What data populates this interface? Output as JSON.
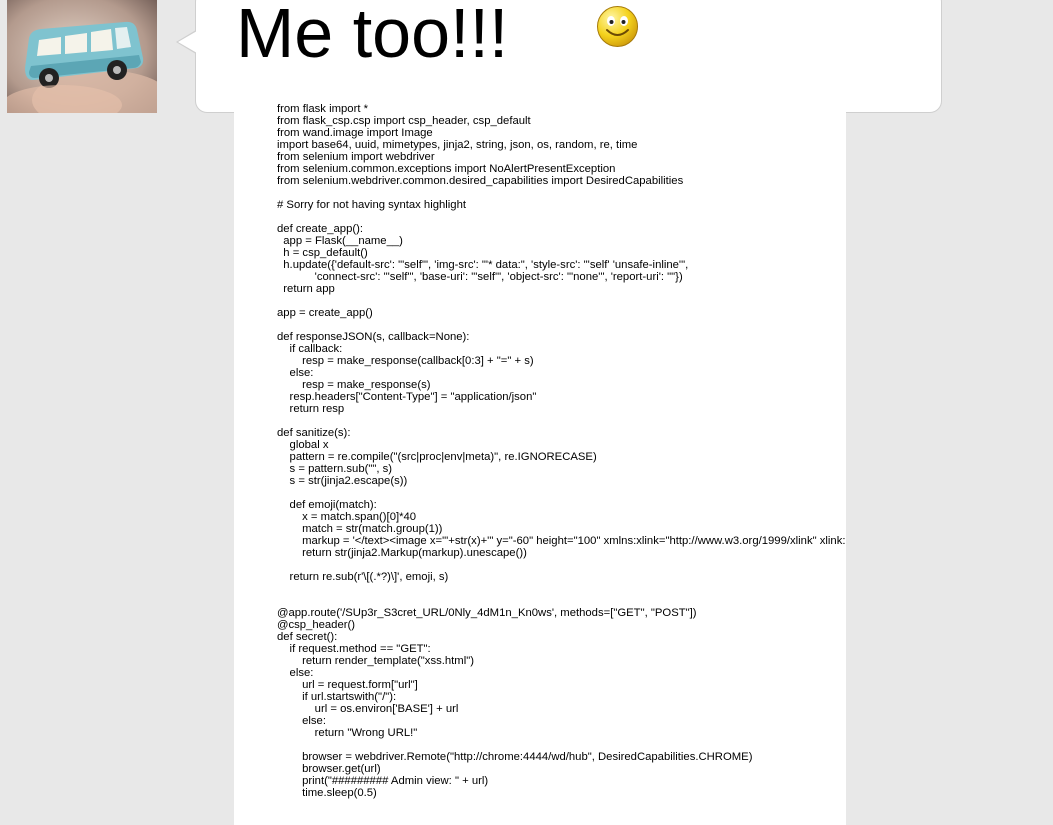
{
  "message": {
    "text": "Me too!!!",
    "emoji": "smiley-face-icon",
    "avatar": "toy-car-avatar"
  },
  "colors": {
    "page_background": "#e8e8e8",
    "bubble_background": "#ffffff",
    "bubble_border": "#cfcfcf",
    "car_body": "#7fc3cf",
    "smiley": "#f4d21c"
  },
  "code": {
    "lines": [
      "from flask import *",
      "from flask_csp.csp import csp_header, csp_default",
      "from wand.image import Image",
      "import base64, uuid, mimetypes, jinja2, string, json, os, random, re, time",
      "from selenium import webdriver",
      "from selenium.common.exceptions import NoAlertPresentException",
      "from selenium.webdriver.common.desired_capabilities import DesiredCapabilities",
      "",
      "# Sorry for not having syntax highlight",
      "",
      "def create_app():",
      "  app = Flask(__name__)",
      "  h = csp_default()",
      "  h.update({'default-src': \"'self'\", 'img-src': \"'* data:\", 'style-src': \"'self' 'unsafe-inline'\",",
      "            'connect-src': \"'self'\", 'base-uri': \"'self'\", 'object-src': \"'none'\", 'report-uri': \"\"})",
      "  return app",
      "",
      "app = create_app()",
      "",
      "def responseJSON(s, callback=None):",
      "    if callback:",
      "        resp = make_response(callback[0:3] + \"=\" + s)",
      "    else:",
      "        resp = make_response(s)",
      "    resp.headers[\"Content-Type\"] = \"application/json\"",
      "    return resp",
      "",
      "def sanitize(s):",
      "    global x",
      "    pattern = re.compile(\"(src|proc|env|meta)\", re.IGNORECASE)",
      "    s = pattern.sub(\"\", s)",
      "    s = str(jinja2.escape(s))",
      "",
      "    def emoji(match):",
      "        x = match.span()[0]*40",
      "        match = str(match.group(1))",
      "        markup = '</text><image x=\"'+str(x)+'\" y=\"-60\" height=\"100\" xmlns:xlink=\"http://www.w3.org/1999/xlink\" xlink:href=\"/static/'+match+'.png\"/><text>'",
      "        return str(jinja2.Markup(markup).unescape())",
      "",
      "    return re.sub(r'\\[(.*?)\\]', emoji, s)",
      "",
      "",
      "@app.route('/SUp3r_S3cret_URL/0Nly_4dM1n_Kn0ws', methods=[\"GET\", \"POST\"])",
      "@csp_header()",
      "def secret():",
      "    if request.method == \"GET\":",
      "        return render_template(\"xss.html\")",
      "    else:",
      "        url = request.form[\"url\"]",
      "        if url.startswith(\"/\"):",
      "            url = os.environ['BASE'] + url",
      "        else:",
      "            return \"Wrong URL!\"",
      "",
      "        browser = webdriver.Remote(\"http://chrome:4444/wd/hub\", DesiredCapabilities.CHROME)",
      "        browser.get(url)",
      "        print(\"######### Admin view: \" + url)",
      "        time.sleep(0.5)"
    ]
  }
}
